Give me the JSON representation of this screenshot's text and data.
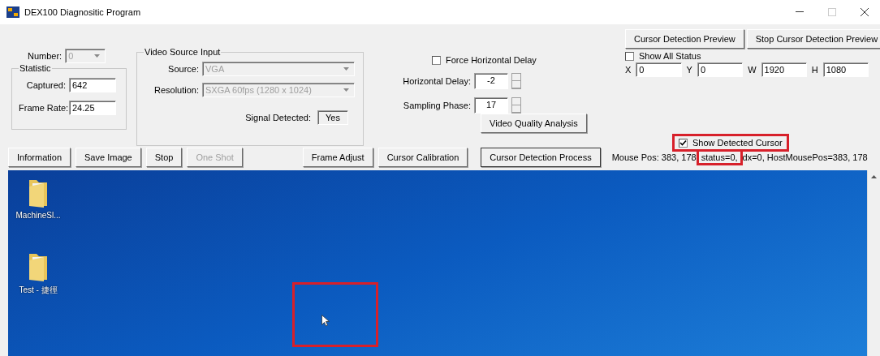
{
  "window": {
    "title": "DEX100 Diagnositic Program"
  },
  "number": {
    "label": "Number:",
    "value": "0",
    "disabled": true
  },
  "statistic": {
    "title": "Statistic",
    "fields": [
      {
        "label": "Captured:",
        "value": "642"
      },
      {
        "label": "Frame Rate:",
        "value": "24.25"
      }
    ]
  },
  "video_source": {
    "title": "Video Source Input",
    "combos": [
      {
        "label": "Source:",
        "value": "VGA",
        "disabled": true
      },
      {
        "label": "Resolution:",
        "value": "SXGA 60fps (1280 x 1024)",
        "disabled": true
      }
    ],
    "signal": {
      "label": "Signal Detected:",
      "value": "Yes"
    }
  },
  "force_horizontal_delay": {
    "label": "Force Horizontal Delay",
    "checked": false
  },
  "spinners": [
    {
      "label": "Horizontal Delay:",
      "value": "-2"
    },
    {
      "label": "Sampling Phase:",
      "value": "17"
    }
  ],
  "video_quality_button": "Video Quality Analysis",
  "preview_buttons": [
    "Cursor Detection Preview",
    "Stop Cursor Detection Preview"
  ],
  "show_all_status": {
    "label": "Show All Status",
    "checked": false
  },
  "region": [
    {
      "label": "X",
      "value": "0"
    },
    {
      "label": "Y",
      "value": "0"
    },
    {
      "label": "W",
      "value": "1920"
    },
    {
      "label": "H",
      "value": "1080"
    }
  ],
  "show_detected_cursor": {
    "label": "Show Detected Cursor",
    "checked": true,
    "highlighted": true
  },
  "buttons_left": [
    {
      "label": "Information",
      "disabled": false,
      "focused": false
    },
    {
      "label": "Save Image",
      "disabled": false,
      "focused": false
    },
    {
      "label": "Stop",
      "disabled": false,
      "focused": false
    },
    {
      "label": "One Shot",
      "disabled": true,
      "focused": false
    }
  ],
  "buttons_right": [
    {
      "label": "Frame Adjust",
      "disabled": false,
      "focused": false
    },
    {
      "label": "Cursor Calibration",
      "disabled": false,
      "focused": false
    },
    {
      "label": "Cursor Detection Process",
      "disabled": false,
      "focused": true
    }
  ],
  "mouse_status": [
    {
      "text": "Mouse Pos: 383, 178",
      "highlighted": false
    },
    {
      "text": "status=0,",
      "highlighted": true
    },
    {
      "text": "dx=0, HostMousePos=383, 178",
      "highlighted": false
    }
  ],
  "desktop": {
    "icons": [
      {
        "label": "MachineSl..."
      },
      {
        "label": "Test - 捷徑"
      }
    ],
    "cursor_highlighted": true
  }
}
